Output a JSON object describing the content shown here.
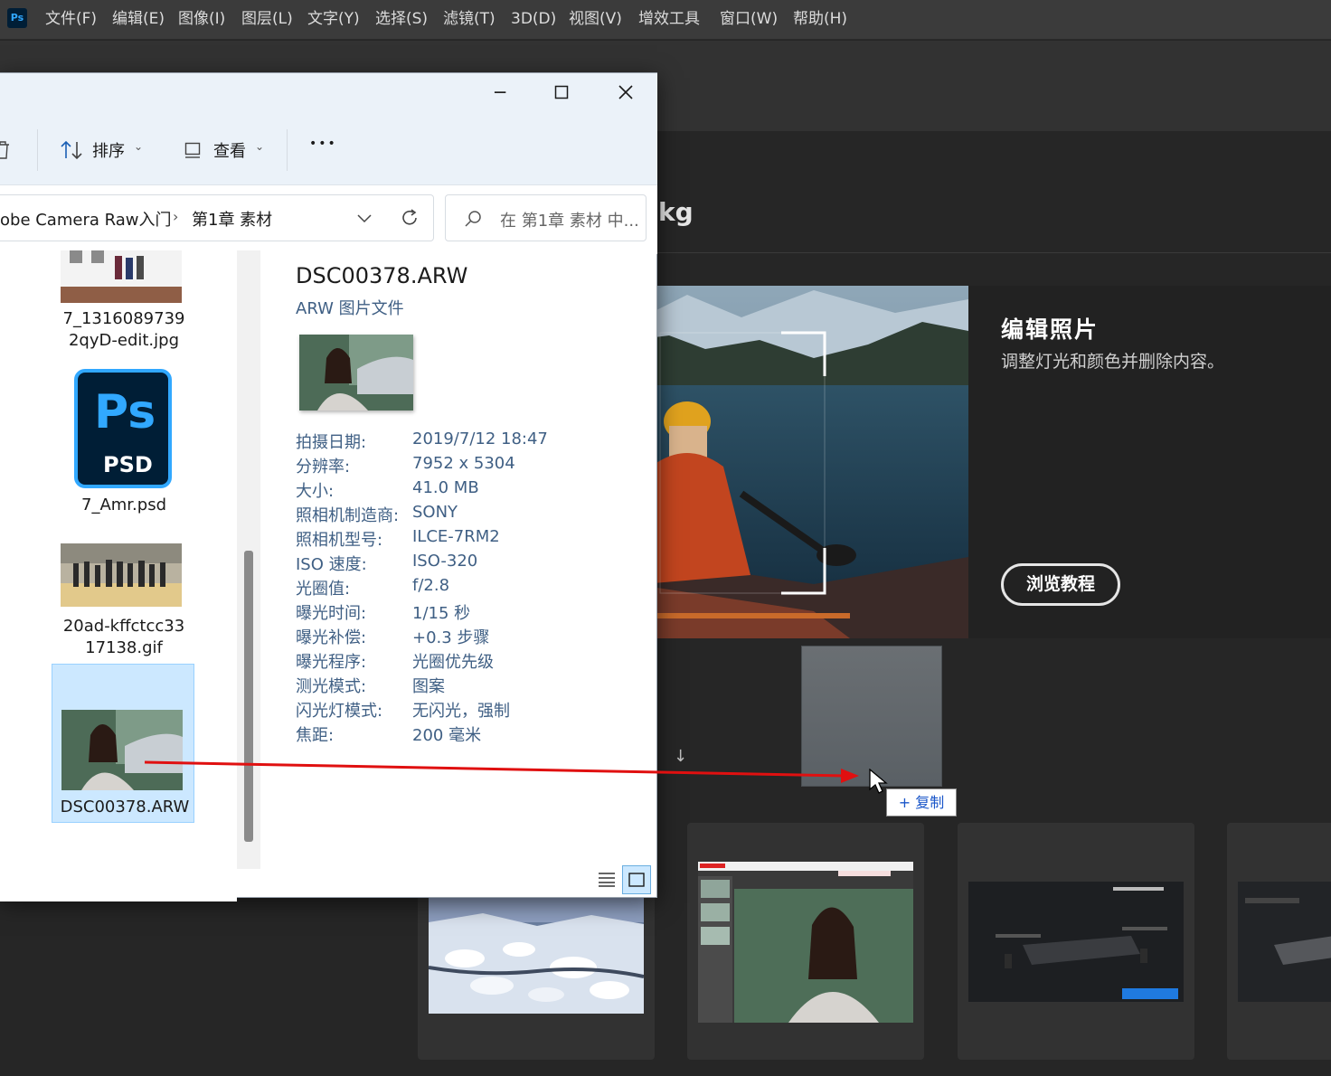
{
  "ps": {
    "logo": "Ps",
    "menu": [
      "文件(F)",
      "编辑(E)",
      "图像(I)",
      "图层(L)",
      "文字(Y)",
      "选择(S)",
      "滤镜(T)",
      "3D(D)",
      "视图(V)",
      "增效工具",
      "窗口(W)",
      "帮助(H)"
    ],
    "title_fragment": "kg",
    "hero": {
      "title": "编辑照片",
      "subtitle": "调整灯光和颜色并删除内容。",
      "button": "浏览教程"
    },
    "drag_copy_label": "+ 复制"
  },
  "explorer": {
    "toolbar": {
      "sort": "排序",
      "view": "查看",
      "more": "•••"
    },
    "breadcrumb": [
      "obe Camera Raw入门",
      "第1章 素材"
    ],
    "search_placeholder": "在 第1章 素材 中...",
    "files": [
      {
        "name_line1": "7_1316089739",
        "name_line2": "2qyD-edit.jpg"
      },
      {
        "name_line1": "7_Amr.psd",
        "name_line2": "",
        "icon_text": "Ps",
        "icon_sub": "PSD"
      },
      {
        "name_line1": "20ad-kffctcc33",
        "name_line2": "17138.gif"
      },
      {
        "name_line1": "DSC00378.ARW",
        "name_line2": ""
      }
    ],
    "preview": {
      "filename": "DSC00378.ARW",
      "filetype": "ARW 图片文件",
      "properties": [
        {
          "label": "拍摄日期:",
          "value": "2019/7/12 18:47"
        },
        {
          "label": "分辨率:",
          "value": "7952 x 5304"
        },
        {
          "label": "大小:",
          "value": "41.0 MB"
        },
        {
          "label": "照相机制造商:",
          "value": "SONY"
        },
        {
          "label": "照相机型号:",
          "value": "ILCE-7RM2"
        },
        {
          "label": "ISO 速度:",
          "value": "ISO-320"
        },
        {
          "label": "光圈值:",
          "value": "f/2.8"
        },
        {
          "label": "曝光时间:",
          "value": "1/15 秒"
        },
        {
          "label": "曝光补偿:",
          "value": "+0.3 步骤"
        },
        {
          "label": "曝光程序:",
          "value": "光圈优先级"
        },
        {
          "label": "测光模式:",
          "value": "图案"
        },
        {
          "label": "闪光灯模式:",
          "value": "无闪光，强制"
        },
        {
          "label": "焦距:",
          "value": "200 毫米"
        }
      ]
    }
  },
  "colors": {
    "ps_bg": "#262626",
    "explorer_titlebar": "#ebf2f9",
    "selection": "#cce8ff",
    "drag_arrow": "#e01010",
    "property_text": "#3f5f84"
  }
}
